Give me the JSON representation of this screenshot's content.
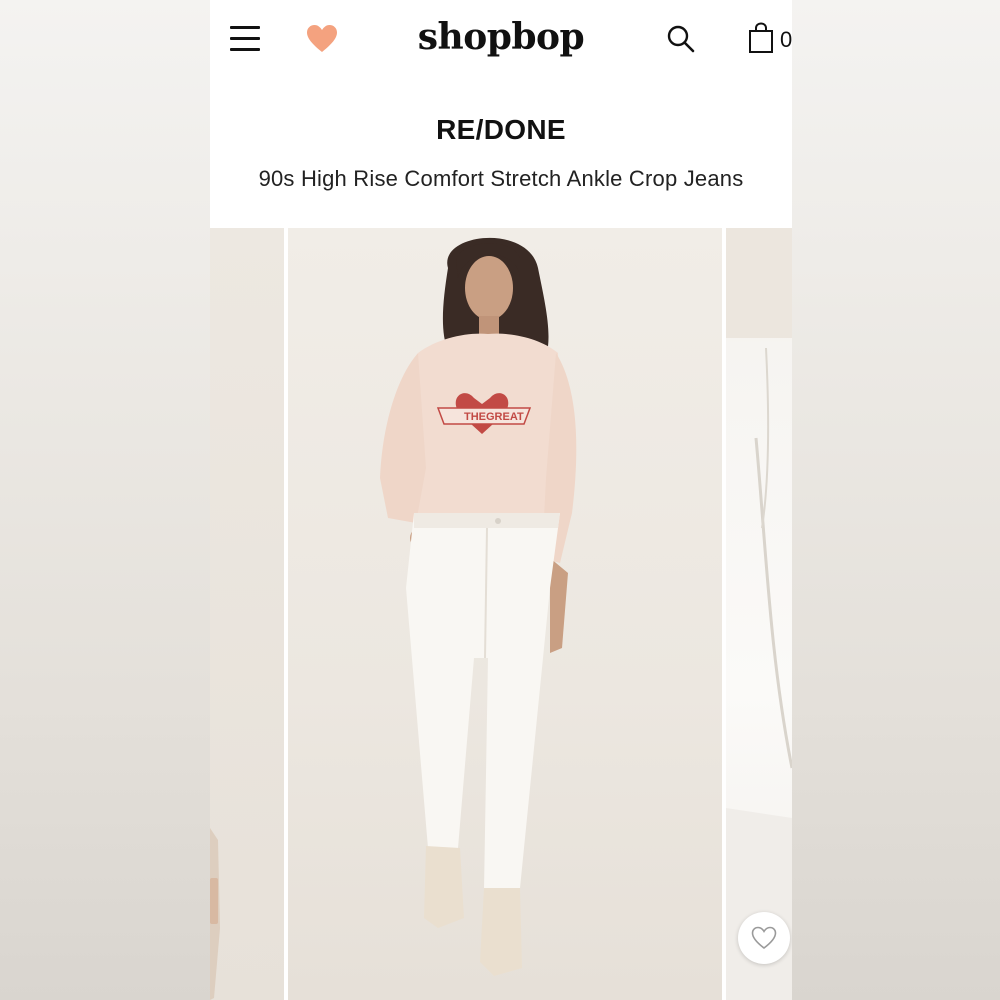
{
  "header": {
    "logo": "shopbop",
    "bag_count": "0",
    "accent_color": "#f4a27f"
  },
  "product": {
    "brand": "RE/DONE",
    "name": "90s High Rise Comfort Stretch Ankle Crop Jeans",
    "sweatshirt_print_top": "THE",
    "sweatshirt_print_bottom": "GREAT"
  },
  "icons": {
    "menu": "hamburger-menu-icon",
    "favorites": "heart-icon",
    "search": "search-icon",
    "bag": "shopping-bag-icon",
    "wishlist": "heart-outline-icon"
  }
}
